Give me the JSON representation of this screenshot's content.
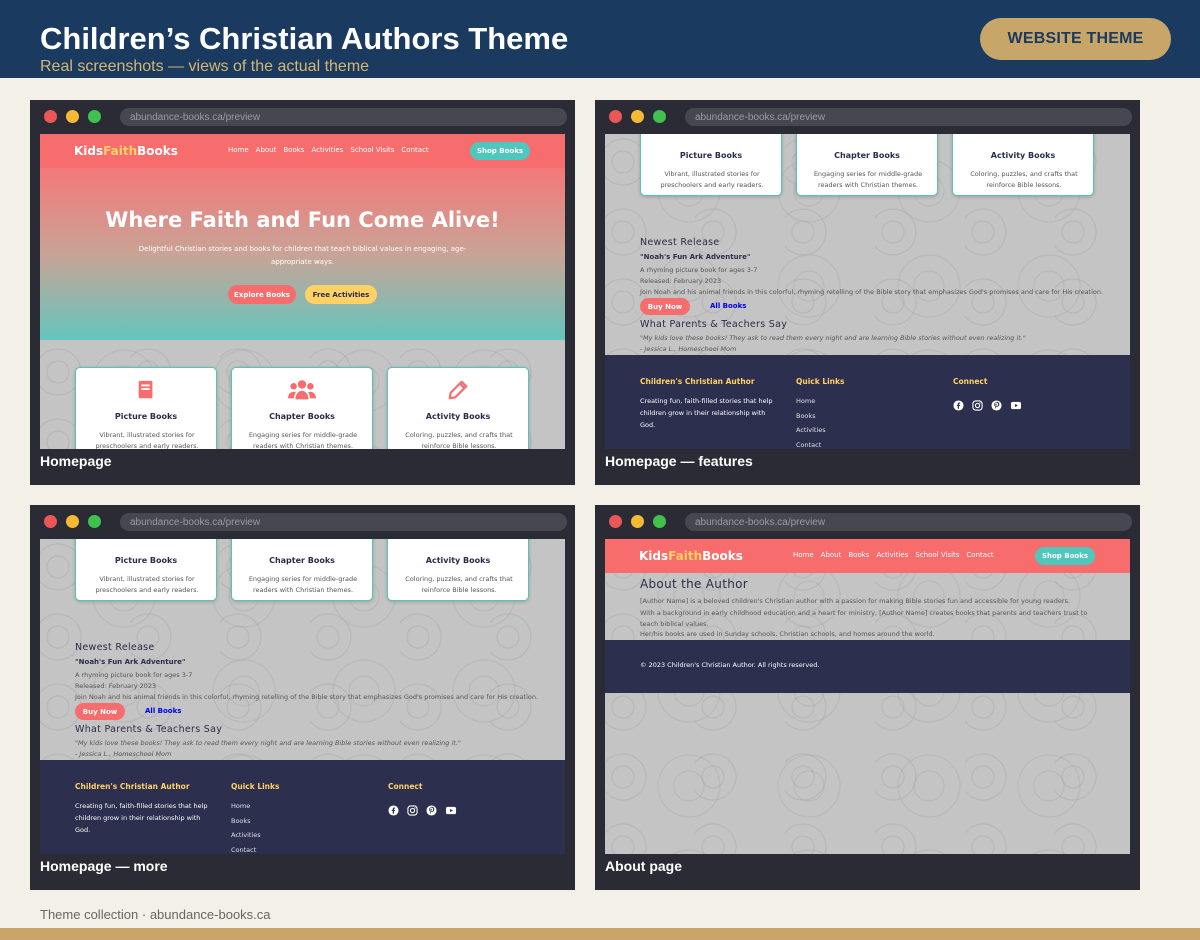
{
  "header": {
    "title": "Children’s Christian Authors Theme",
    "subtitle": "Real screenshots — views of the actual theme",
    "badge": "WEBSITE THEME"
  },
  "browser": {
    "url": "abundance-books.ca/preview"
  },
  "site": {
    "logo_kids": "Kids",
    "logo_faith": "Faith",
    "logo_books": "Books",
    "nav": [
      "Home",
      "About",
      "Books",
      "Activities",
      "School Visits",
      "Contact"
    ],
    "shop": "Shop Books",
    "hero": {
      "heading": "Where Faith and Fun Come Alive!",
      "text": "Delightful Christian stories and books for children that teach biblical values in engaging, age-appropriate ways.",
      "btn1": "Explore Books",
      "btn2": "Free Activities"
    },
    "features": [
      {
        "title": "Picture Books",
        "desc": "Vibrant, illustrated stories for preschoolers and early readers.",
        "icon": "book-icon"
      },
      {
        "title": "Chapter Books",
        "desc": "Engaging series for middle-grade readers with Christian themes.",
        "icon": "users-icon"
      },
      {
        "title": "Activity Books",
        "desc": "Coloring, puzzles, and crafts that reinforce Bible lessons.",
        "icon": "pencil-icon"
      }
    ],
    "release": {
      "heading": "Newest Release",
      "title": "\"Noah's Fun Ark Adventure\"",
      "ages": "A rhyming picture book for ages 3-7",
      "released": "Released: February 2023",
      "desc": "Join Noah and his animal friends in this colorful, rhyming retelling of the Bible story that emphasizes God's promises and care for His creation.",
      "buy": "Buy Now",
      "all": "All Books"
    },
    "testimonial": {
      "heading": "What Parents & Teachers Say",
      "quote": "\"My kids love these books! They ask to read them every night and are learning Bible stories without even realizing it.\"",
      "author": "- Jessica L., Homeschool Mom"
    },
    "footer": {
      "author_heading": "Children's Christian Author",
      "author_text": "Creating fun, faith-filled stories that help children grow in their relationship with God.",
      "links_heading": "Quick Links",
      "links": [
        "Home",
        "Books",
        "Activities",
        "Contact"
      ],
      "connect_heading": "Connect",
      "social": [
        "facebook-icon",
        "instagram-icon",
        "pinterest-icon",
        "youtube-icon"
      ]
    },
    "about": {
      "heading": "About the Author",
      "p1": "[Author Name] is a beloved children's Christian author with a passion for making Bible stories fun and accessible for young readers.",
      "p2": "With a background in early childhood education and a heart for ministry, [Author Name] creates books that parents and teachers trust to teach biblical values.",
      "p3": "Her/his books are used in Sunday schools, Christian schools, and homes around the world.",
      "copyright": "© 2023 Children's Christian Author. All rights reserved."
    }
  },
  "captions": [
    "Homepage",
    "Homepage — features",
    "Homepage — more",
    "About page"
  ],
  "footer_note": "Theme collection · abundance-books.ca",
  "colors": {
    "header_bg": "#1a3a5f",
    "accent_gold": "#c8a66a",
    "coral": "#f76c6c",
    "teal": "#4fc7bd",
    "yellow": "#ffd166",
    "navy_footer": "#2c2f4d"
  }
}
